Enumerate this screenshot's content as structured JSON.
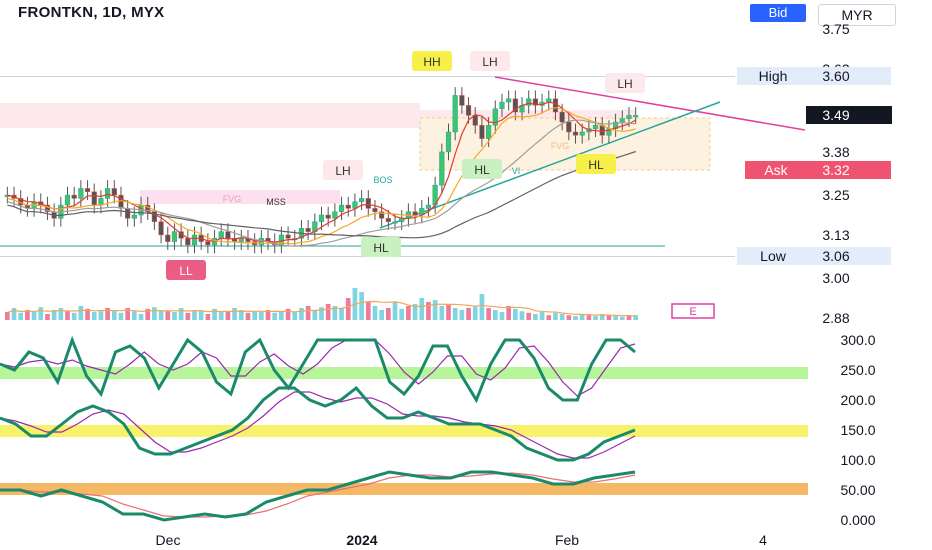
{
  "header": {
    "symbol": "FRONTKN, 1D, MYX",
    "bid_label": "Bid",
    "currency": "MYR"
  },
  "chart_data": [
    {
      "type": "candlestick",
      "title": "FRONTKN, 1D, MYX",
      "ylim": [
        2.85,
        3.78
      ],
      "y_ticks": [
        "3.75",
        "3.63",
        "3.50",
        "3.38",
        "3.25",
        "3.13",
        "3.00",
        "2.88"
      ],
      "x_ticks": [
        "Dec",
        "2024",
        "Feb",
        "4"
      ],
      "price_labels": {
        "high_label": "High",
        "high_value": "3.60",
        "last_value": "3.49",
        "ask_label": "Ask",
        "ask_value": "3.32",
        "low_label": "Low",
        "low_value": "3.06"
      },
      "close": [
        3.25,
        3.24,
        3.22,
        3.21,
        3.23,
        3.22,
        3.2,
        3.18,
        3.22,
        3.25,
        3.24,
        3.27,
        3.26,
        3.22,
        3.24,
        3.27,
        3.25,
        3.21,
        3.18,
        3.19,
        3.22,
        3.2,
        3.17,
        3.13,
        3.11,
        3.14,
        3.12,
        3.1,
        3.13,
        3.11,
        3.1,
        3.12,
        3.14,
        3.12,
        3.11,
        3.12,
        3.11,
        3.1,
        3.12,
        3.11,
        3.1,
        3.13,
        3.12,
        3.12,
        3.15,
        3.14,
        3.17,
        3.19,
        3.18,
        3.2,
        3.22,
        3.21,
        3.23,
        3.24,
        3.21,
        3.2,
        3.18,
        3.17,
        3.17,
        3.18,
        3.2,
        3.19,
        3.21,
        3.22,
        3.28,
        3.38,
        3.44,
        3.55,
        3.52,
        3.49,
        3.46,
        3.42,
        3.46,
        3.51,
        3.53,
        3.54,
        3.5,
        3.52,
        3.54,
        3.52,
        3.53,
        3.54,
        3.5,
        3.47,
        3.44,
        3.43,
        3.44,
        3.45,
        3.46,
        3.43,
        3.45,
        3.47,
        3.48,
        3.49,
        3.49
      ],
      "annotations": [
        "HH",
        "LH",
        "LH",
        "LH",
        "BOS",
        "HL",
        "HL",
        "HL",
        "LL",
        "FVG",
        "MSS",
        "FVG",
        "E",
        "VI"
      ],
      "volume": [
        0.2,
        0.3,
        0.18,
        0.25,
        0.22,
        0.32,
        0.15,
        0.25,
        0.3,
        0.22,
        0.18,
        0.35,
        0.28,
        0.2,
        0.22,
        0.3,
        0.25,
        0.18,
        0.3,
        0.22,
        0.15,
        0.28,
        0.32,
        0.25,
        0.22,
        0.2,
        0.3,
        0.18,
        0.22,
        0.25,
        0.15,
        0.28,
        0.2,
        0.22,
        0.3,
        0.25,
        0.18,
        0.22,
        0.2,
        0.25,
        0.18,
        0.22,
        0.28,
        0.2,
        0.3,
        0.35,
        0.25,
        0.32,
        0.4,
        0.35,
        0.3,
        0.55,
        0.8,
        0.7,
        0.45,
        0.35,
        0.25,
        0.3,
        0.45,
        0.28,
        0.35,
        0.4,
        0.55,
        0.45,
        0.5,
        0.35,
        0.4,
        0.3,
        0.25,
        0.3,
        0.35,
        0.65,
        0.3,
        0.25,
        0.2,
        0.35,
        0.28,
        0.22,
        0.18,
        0.15,
        0.2,
        0.12,
        0.18,
        0.15,
        0.12,
        0.1,
        0.15,
        0.12,
        0.1,
        0.15,
        0.12,
        0.1,
        0.08,
        0.1,
        0.12
      ],
      "volume_label": "E"
    },
    {
      "type": "line",
      "name": "oscillators",
      "y_ticks": [
        "300.0",
        "250.0",
        "200.0",
        "150.0",
        "100.0",
        "50.00",
        "0.000"
      ],
      "ylim": [
        0,
        300
      ],
      "bands": [
        [
          250,
          250
        ],
        [
          150,
          150
        ],
        [
          50,
          50
        ]
      ],
      "series": [
        {
          "values": [
            260,
            250,
            280,
            270,
            230,
            300,
            240,
            210,
            280,
            290,
            270,
            220,
            260,
            300,
            280,
            230,
            210,
            280,
            300,
            250,
            220,
            260,
            300,
            300,
            300,
            300,
            300,
            230,
            210,
            240,
            290,
            290,
            240,
            200,
            260,
            300,
            300,
            270,
            220,
            200,
            200,
            260,
            300,
            300,
            280
          ]
        },
        {
          "values": [
            170,
            160,
            140,
            140,
            160,
            180,
            190,
            180,
            160,
            120,
            110,
            110,
            120,
            130,
            140,
            150,
            170,
            200,
            220,
            220,
            200,
            190,
            200,
            220,
            190,
            170,
            170,
            180,
            170,
            160,
            160,
            160,
            150,
            140,
            120,
            110,
            100,
            100,
            110,
            130,
            140,
            150
          ]
        },
        {
          "values": [
            50,
            50,
            40,
            50,
            40,
            30,
            10,
            10,
            0,
            5,
            10,
            5,
            10,
            30,
            40,
            50,
            50,
            60,
            70,
            80,
            75,
            70,
            70,
            80,
            80,
            75,
            70,
            60,
            60,
            70,
            75,
            80
          ]
        }
      ]
    }
  ]
}
